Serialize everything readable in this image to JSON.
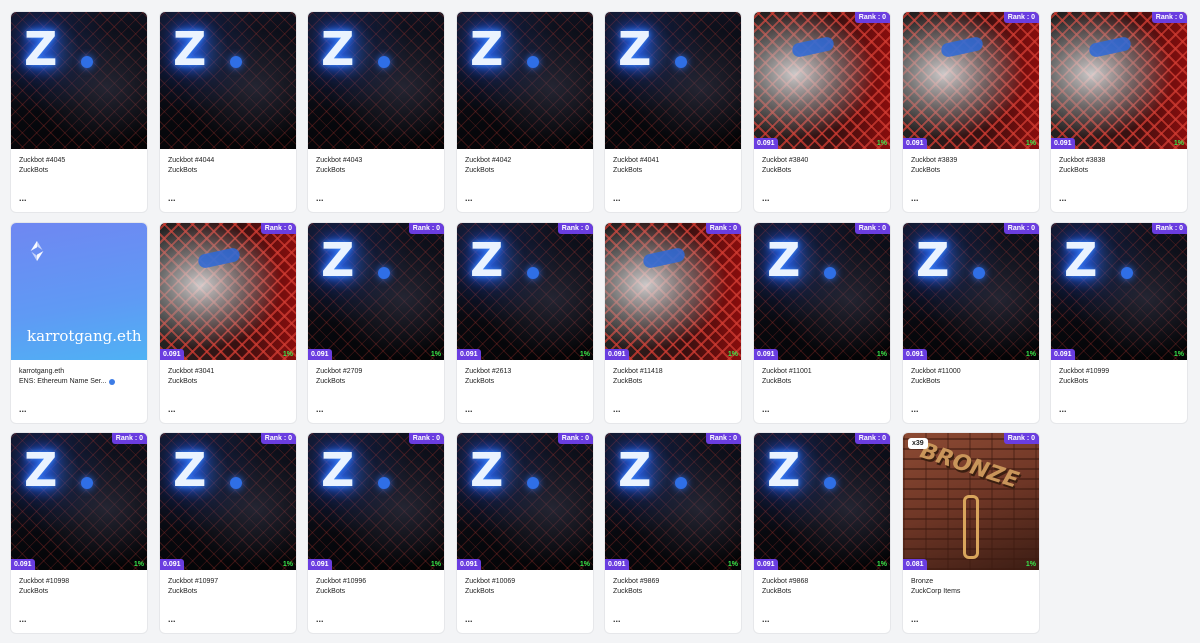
{
  "cards": [
    {
      "name": "Zuckbot #4045",
      "collection": "ZuckBots",
      "art": "z",
      "rank": null,
      "price": null,
      "pct": null,
      "more": "..."
    },
    {
      "name": "Zuckbot #4044",
      "collection": "ZuckBots",
      "art": "z",
      "rank": null,
      "price": null,
      "pct": null,
      "more": "..."
    },
    {
      "name": "Zuckbot #4043",
      "collection": "ZuckBots",
      "art": "z",
      "rank": null,
      "price": null,
      "pct": null,
      "more": "..."
    },
    {
      "name": "Zuckbot #4042",
      "collection": "ZuckBots",
      "art": "z",
      "rank": null,
      "price": null,
      "pct": null,
      "more": "..."
    },
    {
      "name": "Zuckbot #4041",
      "collection": "ZuckBots",
      "art": "z",
      "rank": null,
      "price": null,
      "pct": null,
      "more": "..."
    },
    {
      "name": "Zuckbot #3840",
      "collection": "ZuckBots",
      "art": "fence",
      "rank": "Rank : 0",
      "price": "0.091",
      "pct": "1%",
      "more": "..."
    },
    {
      "name": "Zuckbot #3839",
      "collection": "ZuckBots",
      "art": "fence",
      "rank": "Rank : 0",
      "price": "0.091",
      "pct": "1%",
      "more": "..."
    },
    {
      "name": "Zuckbot #3838",
      "collection": "ZuckBots",
      "art": "fence",
      "rank": "Rank : 0",
      "price": "0.091",
      "pct": "1%",
      "more": "..."
    },
    {
      "name": "karrotgang.eth",
      "collection": "ENS: Ethereum Name Ser...",
      "art": "ens",
      "ens_label": "karrotgang.eth",
      "verified": true,
      "rank": null,
      "price": null,
      "pct": null,
      "more": "..."
    },
    {
      "name": "Zuckbot #3041",
      "collection": "ZuckBots",
      "art": "fence",
      "rank": "Rank : 0",
      "price": "0.091",
      "pct": "1%",
      "more": "..."
    },
    {
      "name": "Zuckbot #2709",
      "collection": "ZuckBots",
      "art": "z",
      "rank": "Rank : 0",
      "price": "0.091",
      "pct": "1%",
      "more": "..."
    },
    {
      "name": "Zuckbot #2613",
      "collection": "ZuckBots",
      "art": "z",
      "rank": "Rank : 0",
      "price": "0.091",
      "pct": "1%",
      "more": "..."
    },
    {
      "name": "Zuckbot #11418",
      "collection": "ZuckBots",
      "art": "fence",
      "rank": "Rank : 0",
      "price": "0.091",
      "pct": "1%",
      "more": "..."
    },
    {
      "name": "Zuckbot #11001",
      "collection": "ZuckBots",
      "art": "z",
      "rank": "Rank : 0",
      "price": "0.091",
      "pct": "1%",
      "more": "..."
    },
    {
      "name": "Zuckbot #11000",
      "collection": "ZuckBots",
      "art": "z",
      "rank": "Rank : 0",
      "price": "0.091",
      "pct": "1%",
      "more": "..."
    },
    {
      "name": "Zuckbot #10999",
      "collection": "ZuckBots",
      "art": "z",
      "rank": "Rank : 0",
      "price": "0.091",
      "pct": "1%",
      "more": "..."
    },
    {
      "name": "Zuckbot #10998",
      "collection": "ZuckBots",
      "art": "z",
      "rank": "Rank : 0",
      "price": "0.091",
      "pct": "1%",
      "more": "..."
    },
    {
      "name": "Zuckbot #10997",
      "collection": "ZuckBots",
      "art": "z",
      "rank": "Rank : 0",
      "price": "0.091",
      "pct": "1%",
      "more": "..."
    },
    {
      "name": "Zuckbot #10996",
      "collection": "ZuckBots",
      "art": "z",
      "rank": "Rank : 0",
      "price": "0.091",
      "pct": "1%",
      "more": "..."
    },
    {
      "name": "Zuckbot #10069",
      "collection": "ZuckBots",
      "art": "z",
      "rank": "Rank : 0",
      "price": "0.091",
      "pct": "1%",
      "more": "..."
    },
    {
      "name": "Zuckbot #9869",
      "collection": "ZuckBots",
      "art": "z",
      "rank": "Rank : 0",
      "price": "0.091",
      "pct": "1%",
      "more": "..."
    },
    {
      "name": "Zuckbot #9868",
      "collection": "ZuckBots",
      "art": "z",
      "rank": "Rank : 0",
      "price": "0.091",
      "pct": "1%",
      "more": "..."
    },
    {
      "name": "Bronze",
      "collection": "ZuckCorp Items",
      "art": "bronze",
      "qty": "x39",
      "rank": "Rank : 0",
      "price": "0.081",
      "pct": "1%",
      "more": "..."
    }
  ],
  "colors": {
    "badge": "#6a3de0",
    "pct": "#39e64a",
    "card_bg": "#ffffff",
    "page_bg": "#f3f4f6"
  },
  "icons": {
    "ens": "ens-logo-icon",
    "verified": "verified-badge-icon",
    "more": "more-options-icon"
  }
}
